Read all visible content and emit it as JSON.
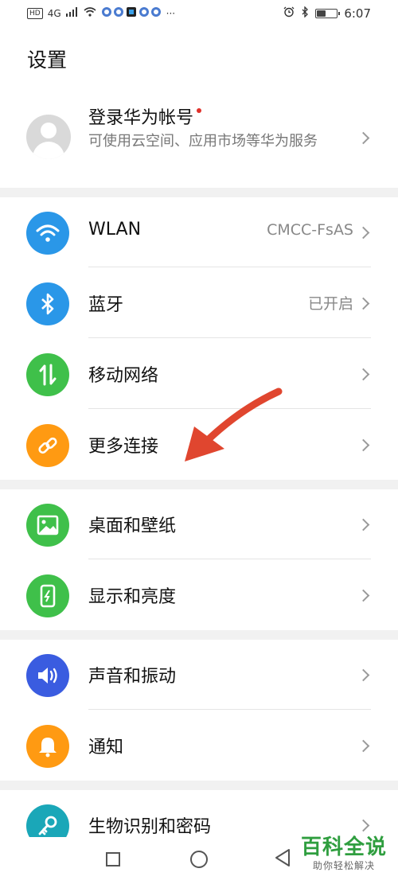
{
  "status_bar": {
    "hd": "HD",
    "network": "4G",
    "more": "···",
    "time": "6:07"
  },
  "page": {
    "title": "设置"
  },
  "account": {
    "title": "登录华为帐号",
    "subtitle": "可使用云空间、应用市场等华为服务"
  },
  "sections": [
    {
      "items": [
        {
          "label": "WLAN",
          "value": "CMCC-FsAS",
          "icon": "wifi-icon",
          "color": "#2a97e8"
        },
        {
          "label": "蓝牙",
          "value": "已开启",
          "icon": "bluetooth-icon",
          "color": "#2a97e8"
        },
        {
          "label": "移动网络",
          "value": "",
          "icon": "mobile-data-icon",
          "color": "#3fc04a"
        },
        {
          "label": "更多连接",
          "value": "",
          "icon": "link-icon",
          "color": "#ff9a12"
        }
      ]
    },
    {
      "items": [
        {
          "label": "桌面和壁纸",
          "value": "",
          "icon": "wallpaper-icon",
          "color": "#3fc04a"
        },
        {
          "label": "显示和亮度",
          "value": "",
          "icon": "display-icon",
          "color": "#3fc04a"
        }
      ]
    },
    {
      "items": [
        {
          "label": "声音和振动",
          "value": "",
          "icon": "sound-icon",
          "color": "#3a5ce0"
        },
        {
          "label": "通知",
          "value": "",
          "icon": "bell-icon",
          "color": "#ff9a12"
        }
      ]
    },
    {
      "items": [
        {
          "label": "生物识别和密码",
          "value": "",
          "icon": "key-icon",
          "color": "#1aa7b8"
        }
      ]
    }
  ],
  "watermark": {
    "title": "百科全说",
    "subtitle": "助你轻松解决"
  },
  "annotation": {
    "arrow_color": "#e0462f"
  }
}
